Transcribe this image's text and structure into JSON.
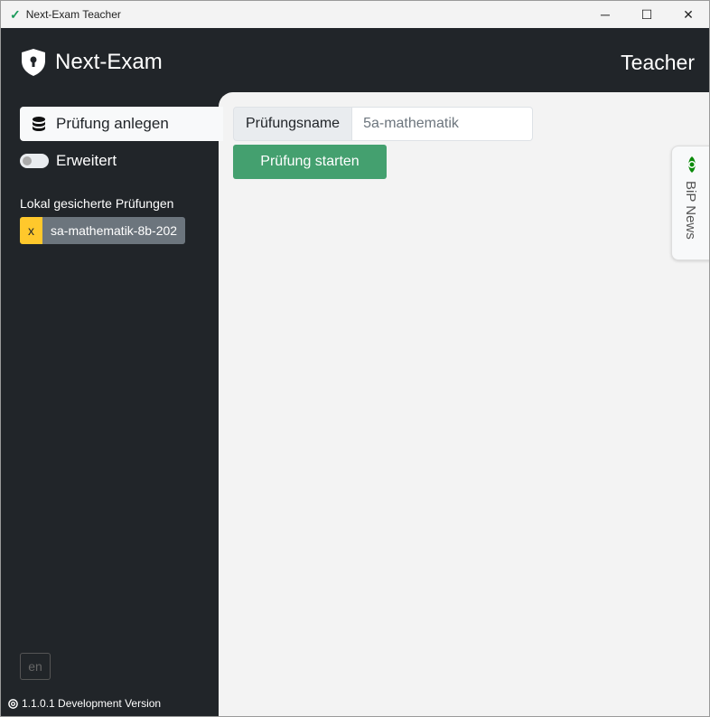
{
  "window": {
    "title": "Next-Exam Teacher",
    "minimize": "─",
    "maximize": "☐",
    "close": "✕"
  },
  "header": {
    "app_name": "Next-Exam",
    "role": "Teacher"
  },
  "sidebar": {
    "create_exam": "Prüfung anlegen",
    "advanced_toggle": "Erweitert",
    "advanced_on": false,
    "saved_label": "Lokal gesicherte Prüfungen",
    "saved_exams": [
      {
        "remove": "x",
        "name": "sa-mathematik-8b-202"
      }
    ],
    "language": "en",
    "version": "1.1.0.1 Development Version"
  },
  "main": {
    "exam_name_label": "Prüfungsname",
    "exam_name_value": "5a-mathematik",
    "start_button": "Prüfung starten"
  },
  "news_tab": {
    "label": "BiP News",
    "accent": "#0a8a0a"
  }
}
